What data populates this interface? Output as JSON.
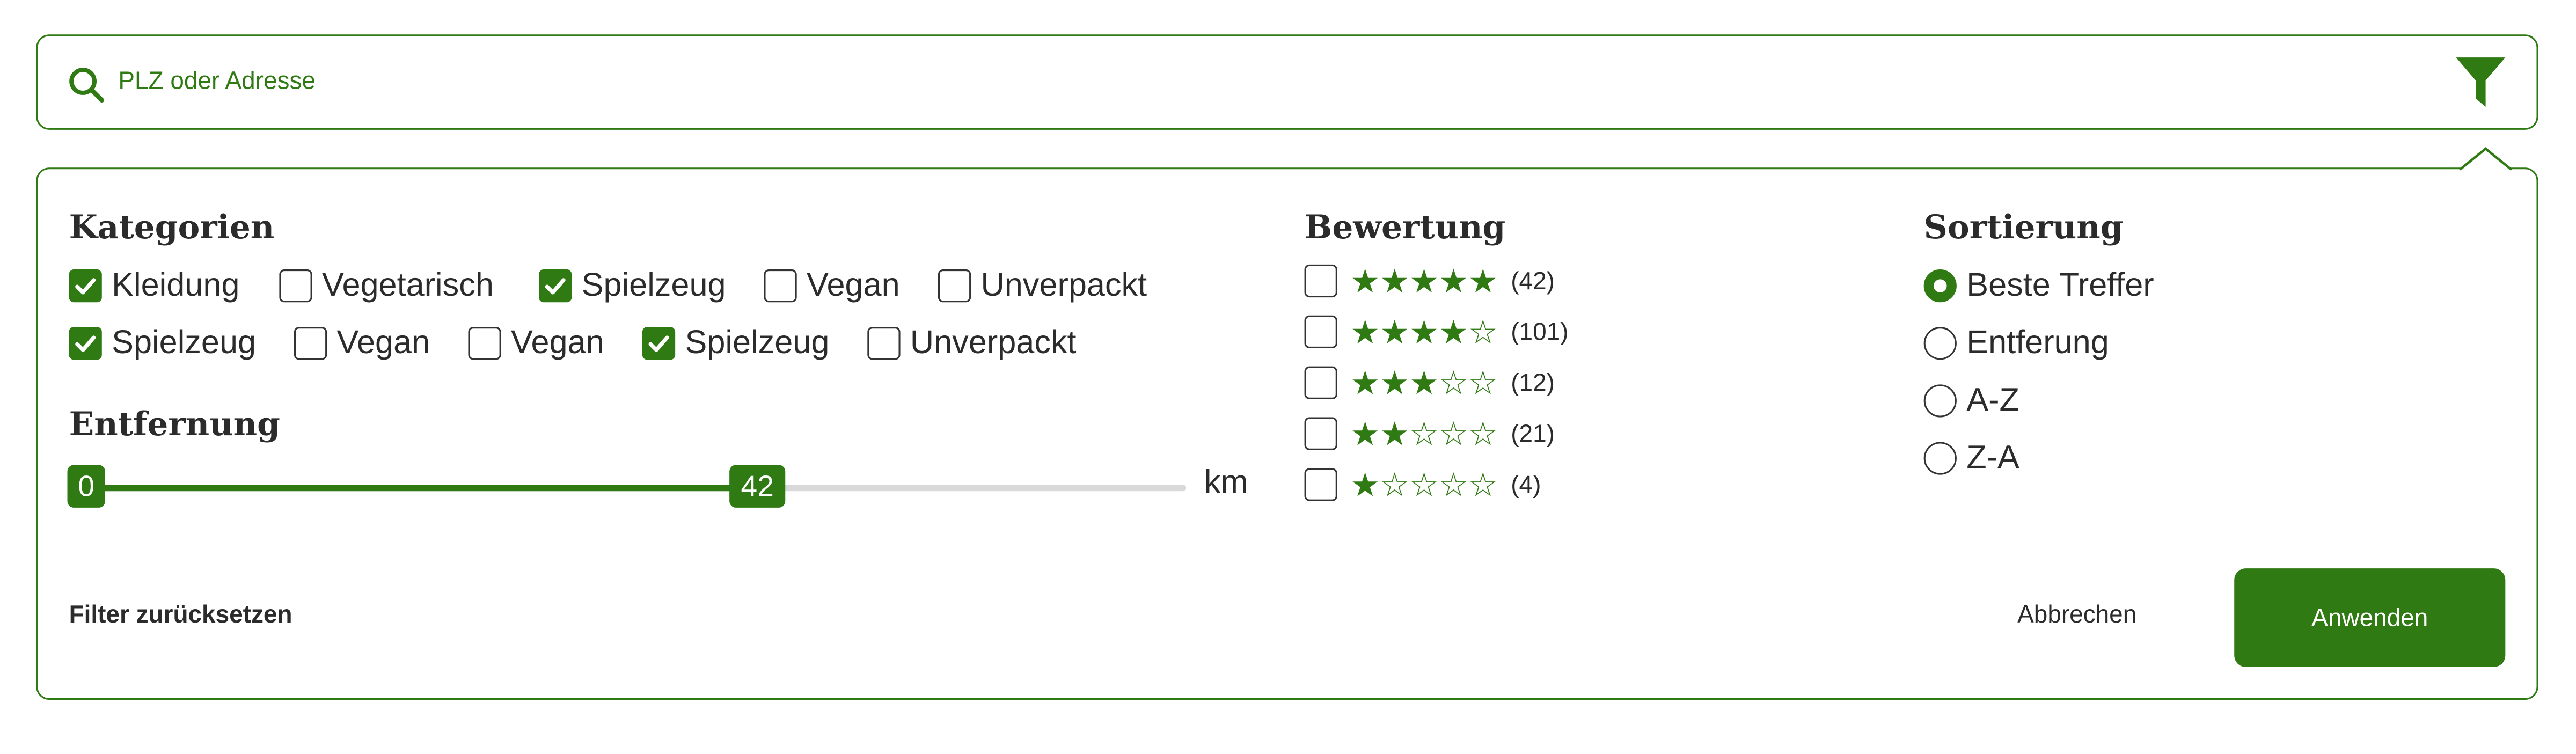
{
  "colors": {
    "accent": "#2f7a12",
    "track": "#d9d9d9"
  },
  "search": {
    "placeholder": "PLZ oder Adresse",
    "icon": "search-icon",
    "filter_icon": "filter-icon"
  },
  "kategorien": {
    "title": "Kategorien",
    "items": [
      {
        "label": "Kleidung",
        "checked": true
      },
      {
        "label": "Vegetarisch",
        "checked": false
      },
      {
        "label": "Spielzeug",
        "checked": true
      },
      {
        "label": "Vegan",
        "checked": false
      },
      {
        "label": "Unverpackt",
        "checked": false
      },
      {
        "label": "Spielzeug",
        "checked": true
      },
      {
        "label": "Vegan",
        "checked": false
      },
      {
        "label": "Vegan",
        "checked": false
      },
      {
        "label": "Spielzeug",
        "checked": true
      },
      {
        "label": "Unverpackt",
        "checked": false
      }
    ]
  },
  "entfernung": {
    "title": "Entfernung",
    "min_label": "0",
    "value_label": "42",
    "unit": "km",
    "fill_fraction": 0.61
  },
  "bewertung": {
    "title": "Bewertung",
    "items": [
      {
        "stars": 5,
        "count": "(42)",
        "checked": false
      },
      {
        "stars": 4,
        "count": "(101)",
        "checked": false
      },
      {
        "stars": 3,
        "count": "(12)",
        "checked": false
      },
      {
        "stars": 2,
        "count": "(21)",
        "checked": false
      },
      {
        "stars": 1,
        "count": "(4)",
        "checked": false
      }
    ]
  },
  "sortierung": {
    "title": "Sortierung",
    "options": [
      {
        "label": "Beste Treffer",
        "selected": true
      },
      {
        "label": "Entferung",
        "selected": false
      },
      {
        "label": "A-Z",
        "selected": false
      },
      {
        "label": "Z-A",
        "selected": false
      }
    ]
  },
  "actions": {
    "reset": "Filter zurücksetzen",
    "cancel": "Abbrechen",
    "apply": "Anwenden"
  }
}
